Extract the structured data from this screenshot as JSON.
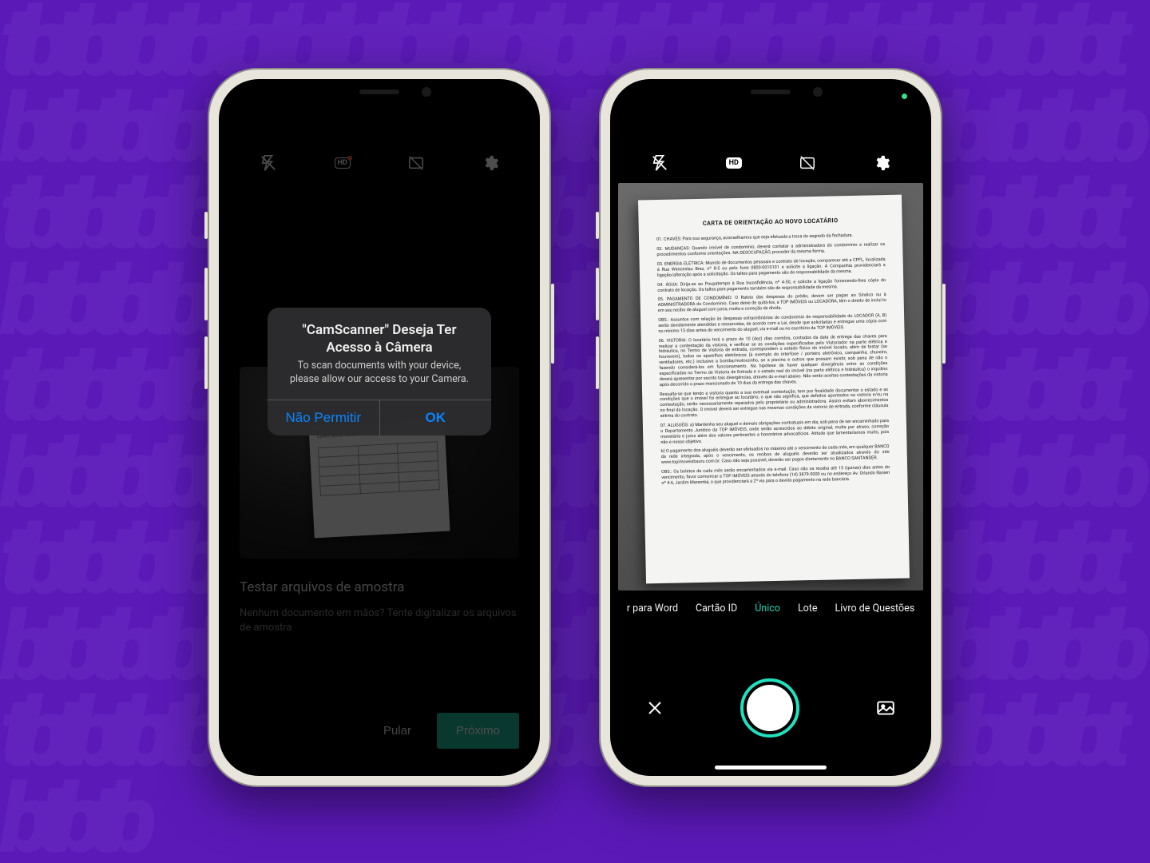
{
  "colors": {
    "accent": "#1fe0c0",
    "brand_bg": "#5b19b8",
    "ios_blue": "#0b84ff",
    "btn_teal": "#1fb89a"
  },
  "alert": {
    "title": "\"CamScanner\" Deseja Ter Acesso à Câmera",
    "message": "To scan documents with your device, please allow our access to your Camera.",
    "deny": "Não Permitir",
    "ok": "OK"
  },
  "sample": {
    "title": "Testar arquivos de amostra",
    "desc": "Nenhum documento em mãos? Tente digitalizar os arquivos de amostra",
    "skip": "Pular",
    "next": "Próximo"
  },
  "toolbar": {
    "hd": "HD"
  },
  "modes": {
    "m0": "r para Word",
    "m1": "Cartão ID",
    "m2": "Único",
    "m3": "Lote",
    "m4": "Livro de Questões"
  },
  "document": {
    "title": "CARTA DE ORIENTAÇÃO AO NOVO LOCATÁRIO",
    "p1": "01. CHAVES: Para sua segurança, aconselhamos que seja efetuada a troca do segredo da fechadura.",
    "p2": "02. MUDANÇAS: Quando imóvel de condomínio, deverá contatar a administradora do condomínio e realizar os procedimentos conforme orientações. NA DESOCUPAÇÃO, proceder da mesma forma.",
    "p3": "03. ENERGIA ELÉTRICA: Munido de documentos pessoais e contrato de locação, comparecer até a CPFL, localizada à Rua Wenceslau Braz, nº 8‑5 ou pelo fone 0800‑0010101 e solicite a ligação. A Companhia providenciará a ligação/alteração após a solicitação. Os taltes para pagamento são de responsabilidade da mesma.",
    "p4": "04. ÁGUA: Dirija‑se ao Poupatempo à Rua Inconfidência, nº 4‑50, e solicite a ligação fornecendo‑lhes cópia do contrato de locação. Os taltes para pagamento também são de responsabilidade da mesma.",
    "p5": "05. PAGAMENTO DE CONDOMÍNIO: O Rateio das despesas do prédio, devem ser pagas ao Síndico ou à ADMINISTRADORA do Condomínio. Caso deixe de quitá‑los, a TOP IMÓVEIS ou LOCADORA, têm o direito de inclui‑lo em seu recibo de aluguel com juros, multa e correção de dívida.",
    "p6": "OBS.: Assuntos com relação às despesas extraordinárias do condomínio de responsabilidade do LOCADOR (A, B) serão devidamente atendidas e ressarcidas, de acordo com a Lei, desde que solicitadas e entregue uma cópia com no mínimo 15 dias antes do vencimento do aluguel, via e‑mail ou no escritório da TOP IMÓVEIS.",
    "p7": "06. VISTORIA: O locatário terá o prazo de 10 (dez) dias corridos, contados da data de entrega das chaves para realizar a contestação da vistoria, e verificar se as condições especificadas pelo Vistoriador na parte elétrica e hidráulica, no Termo de Vistoria de entrada, correspondem o estado físico do imóvel locado, além de testar (se houverem), todos os aparelhos eletrônicos (à exemplo do interfone / porteiro eletrônico, campainha, chuveiro, ventiladores, etc.) inclusive a bomba/motorzinho, se a piscina e outros que possam existir, sob pena de não o fazendo considerá‑los em funcionamento. Na hipótese de haver qualquer divergência entre as condições especificadas no Termo de Vistoria de Entrada e o estado real do imóvel (na parte elétrica e hidráulica) o inquilino deverá apresentar por escrito tais divergências, através do e‑mail abaixo. Não serão aceitas contestações da vistoria após decorrido o prazo mencionado de 10 dias da entrega das chaves.",
    "p8": "Ressalta‑se que tendo a vistoria quanto a sua eventual contestação, tem por finalidade documentar o estado e as condições que o imóvel foi entregue ao locatário, o que não significa, que defeitos apontados na vistoria e/ou na contestação, serão necessariamente reparados pelo proprietário ou administradora. Assim evitam aborrecimentos no final da locação. O imóvel deverá ser entregue nas mesmas condições da vistoria de entrada, conforme cláusula sétima do contrato.",
    "p9": "07. ALUGUÉIS: a) Mantenha seu aluguel e demais obrigações contratuais em dia, sob pena de ser encaminhado para o Departamento Jurídico da TOP IMÓVEIS, onde serão acrescidos ao débito original, multa por atraso, correção monetária e juros além dos valores pertinentes a honorários advocatícios. Atitude que lamentaríamos muito, pois não é nosso objetivo.",
    "p10": "b) O pagamento dos aluguéis deverão ser efetuados no máximo até o vencimento de cada mês, em qualquer BANCO da rede integrada, após o vencimento, os recibos de aluguéis deverão ser atualizados através do site www.topimoveisbauru.com.br. Caso não seja possível, deverão ser pagos diretamente no BANCO SANTANDER.",
    "p11": "OBS.: Os boletos de cada mês serão encaminhados via e‑mail. Caso não os receba até 15 (quinze) dias antes do vencimento, favor comunicar a TOP IMÓVEIS através do telefone (14) 3879‑5000 ou no endereço Av. Orlando Ranieri nº 4‑6, Jardim Marambá, o que providenciará a 2ª via para o devido pagamento na rede bancária."
  }
}
